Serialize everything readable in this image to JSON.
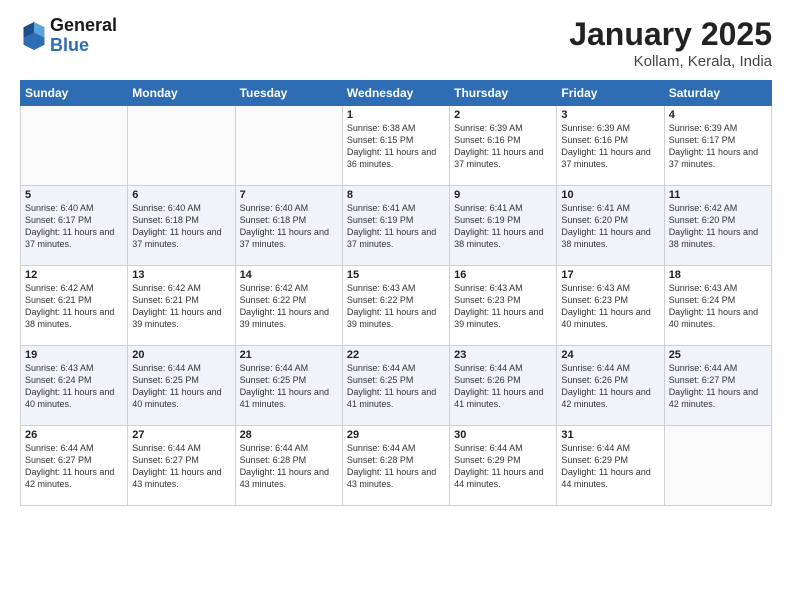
{
  "header": {
    "logo_line1": "General",
    "logo_line2": "Blue",
    "month": "January 2025",
    "location": "Kollam, Kerala, India"
  },
  "weekdays": [
    "Sunday",
    "Monday",
    "Tuesday",
    "Wednesday",
    "Thursday",
    "Friday",
    "Saturday"
  ],
  "weeks": [
    [
      {
        "day": "",
        "sunrise": "",
        "sunset": "",
        "daylight": ""
      },
      {
        "day": "",
        "sunrise": "",
        "sunset": "",
        "daylight": ""
      },
      {
        "day": "",
        "sunrise": "",
        "sunset": "",
        "daylight": ""
      },
      {
        "day": "1",
        "sunrise": "Sunrise: 6:38 AM",
        "sunset": "Sunset: 6:15 PM",
        "daylight": "Daylight: 11 hours and 36 minutes."
      },
      {
        "day": "2",
        "sunrise": "Sunrise: 6:39 AM",
        "sunset": "Sunset: 6:16 PM",
        "daylight": "Daylight: 11 hours and 37 minutes."
      },
      {
        "day": "3",
        "sunrise": "Sunrise: 6:39 AM",
        "sunset": "Sunset: 6:16 PM",
        "daylight": "Daylight: 11 hours and 37 minutes."
      },
      {
        "day": "4",
        "sunrise": "Sunrise: 6:39 AM",
        "sunset": "Sunset: 6:17 PM",
        "daylight": "Daylight: 11 hours and 37 minutes."
      }
    ],
    [
      {
        "day": "5",
        "sunrise": "Sunrise: 6:40 AM",
        "sunset": "Sunset: 6:17 PM",
        "daylight": "Daylight: 11 hours and 37 minutes."
      },
      {
        "day": "6",
        "sunrise": "Sunrise: 6:40 AM",
        "sunset": "Sunset: 6:18 PM",
        "daylight": "Daylight: 11 hours and 37 minutes."
      },
      {
        "day": "7",
        "sunrise": "Sunrise: 6:40 AM",
        "sunset": "Sunset: 6:18 PM",
        "daylight": "Daylight: 11 hours and 37 minutes."
      },
      {
        "day": "8",
        "sunrise": "Sunrise: 6:41 AM",
        "sunset": "Sunset: 6:19 PM",
        "daylight": "Daylight: 11 hours and 37 minutes."
      },
      {
        "day": "9",
        "sunrise": "Sunrise: 6:41 AM",
        "sunset": "Sunset: 6:19 PM",
        "daylight": "Daylight: 11 hours and 38 minutes."
      },
      {
        "day": "10",
        "sunrise": "Sunrise: 6:41 AM",
        "sunset": "Sunset: 6:20 PM",
        "daylight": "Daylight: 11 hours and 38 minutes."
      },
      {
        "day": "11",
        "sunrise": "Sunrise: 6:42 AM",
        "sunset": "Sunset: 6:20 PM",
        "daylight": "Daylight: 11 hours and 38 minutes."
      }
    ],
    [
      {
        "day": "12",
        "sunrise": "Sunrise: 6:42 AM",
        "sunset": "Sunset: 6:21 PM",
        "daylight": "Daylight: 11 hours and 38 minutes."
      },
      {
        "day": "13",
        "sunrise": "Sunrise: 6:42 AM",
        "sunset": "Sunset: 6:21 PM",
        "daylight": "Daylight: 11 hours and 39 minutes."
      },
      {
        "day": "14",
        "sunrise": "Sunrise: 6:42 AM",
        "sunset": "Sunset: 6:22 PM",
        "daylight": "Daylight: 11 hours and 39 minutes."
      },
      {
        "day": "15",
        "sunrise": "Sunrise: 6:43 AM",
        "sunset": "Sunset: 6:22 PM",
        "daylight": "Daylight: 11 hours and 39 minutes."
      },
      {
        "day": "16",
        "sunrise": "Sunrise: 6:43 AM",
        "sunset": "Sunset: 6:23 PM",
        "daylight": "Daylight: 11 hours and 39 minutes."
      },
      {
        "day": "17",
        "sunrise": "Sunrise: 6:43 AM",
        "sunset": "Sunset: 6:23 PM",
        "daylight": "Daylight: 11 hours and 40 minutes."
      },
      {
        "day": "18",
        "sunrise": "Sunrise: 6:43 AM",
        "sunset": "Sunset: 6:24 PM",
        "daylight": "Daylight: 11 hours and 40 minutes."
      }
    ],
    [
      {
        "day": "19",
        "sunrise": "Sunrise: 6:43 AM",
        "sunset": "Sunset: 6:24 PM",
        "daylight": "Daylight: 11 hours and 40 minutes."
      },
      {
        "day": "20",
        "sunrise": "Sunrise: 6:44 AM",
        "sunset": "Sunset: 6:25 PM",
        "daylight": "Daylight: 11 hours and 40 minutes."
      },
      {
        "day": "21",
        "sunrise": "Sunrise: 6:44 AM",
        "sunset": "Sunset: 6:25 PM",
        "daylight": "Daylight: 11 hours and 41 minutes."
      },
      {
        "day": "22",
        "sunrise": "Sunrise: 6:44 AM",
        "sunset": "Sunset: 6:25 PM",
        "daylight": "Daylight: 11 hours and 41 minutes."
      },
      {
        "day": "23",
        "sunrise": "Sunrise: 6:44 AM",
        "sunset": "Sunset: 6:26 PM",
        "daylight": "Daylight: 11 hours and 41 minutes."
      },
      {
        "day": "24",
        "sunrise": "Sunrise: 6:44 AM",
        "sunset": "Sunset: 6:26 PM",
        "daylight": "Daylight: 11 hours and 42 minutes."
      },
      {
        "day": "25",
        "sunrise": "Sunrise: 6:44 AM",
        "sunset": "Sunset: 6:27 PM",
        "daylight": "Daylight: 11 hours and 42 minutes."
      }
    ],
    [
      {
        "day": "26",
        "sunrise": "Sunrise: 6:44 AM",
        "sunset": "Sunset: 6:27 PM",
        "daylight": "Daylight: 11 hours and 42 minutes."
      },
      {
        "day": "27",
        "sunrise": "Sunrise: 6:44 AM",
        "sunset": "Sunset: 6:27 PM",
        "daylight": "Daylight: 11 hours and 43 minutes."
      },
      {
        "day": "28",
        "sunrise": "Sunrise: 6:44 AM",
        "sunset": "Sunset: 6:28 PM",
        "daylight": "Daylight: 11 hours and 43 minutes."
      },
      {
        "day": "29",
        "sunrise": "Sunrise: 6:44 AM",
        "sunset": "Sunset: 6:28 PM",
        "daylight": "Daylight: 11 hours and 43 minutes."
      },
      {
        "day": "30",
        "sunrise": "Sunrise: 6:44 AM",
        "sunset": "Sunset: 6:29 PM",
        "daylight": "Daylight: 11 hours and 44 minutes."
      },
      {
        "day": "31",
        "sunrise": "Sunrise: 6:44 AM",
        "sunset": "Sunset: 6:29 PM",
        "daylight": "Daylight: 11 hours and 44 minutes."
      },
      {
        "day": "",
        "sunrise": "",
        "sunset": "",
        "daylight": ""
      }
    ]
  ]
}
